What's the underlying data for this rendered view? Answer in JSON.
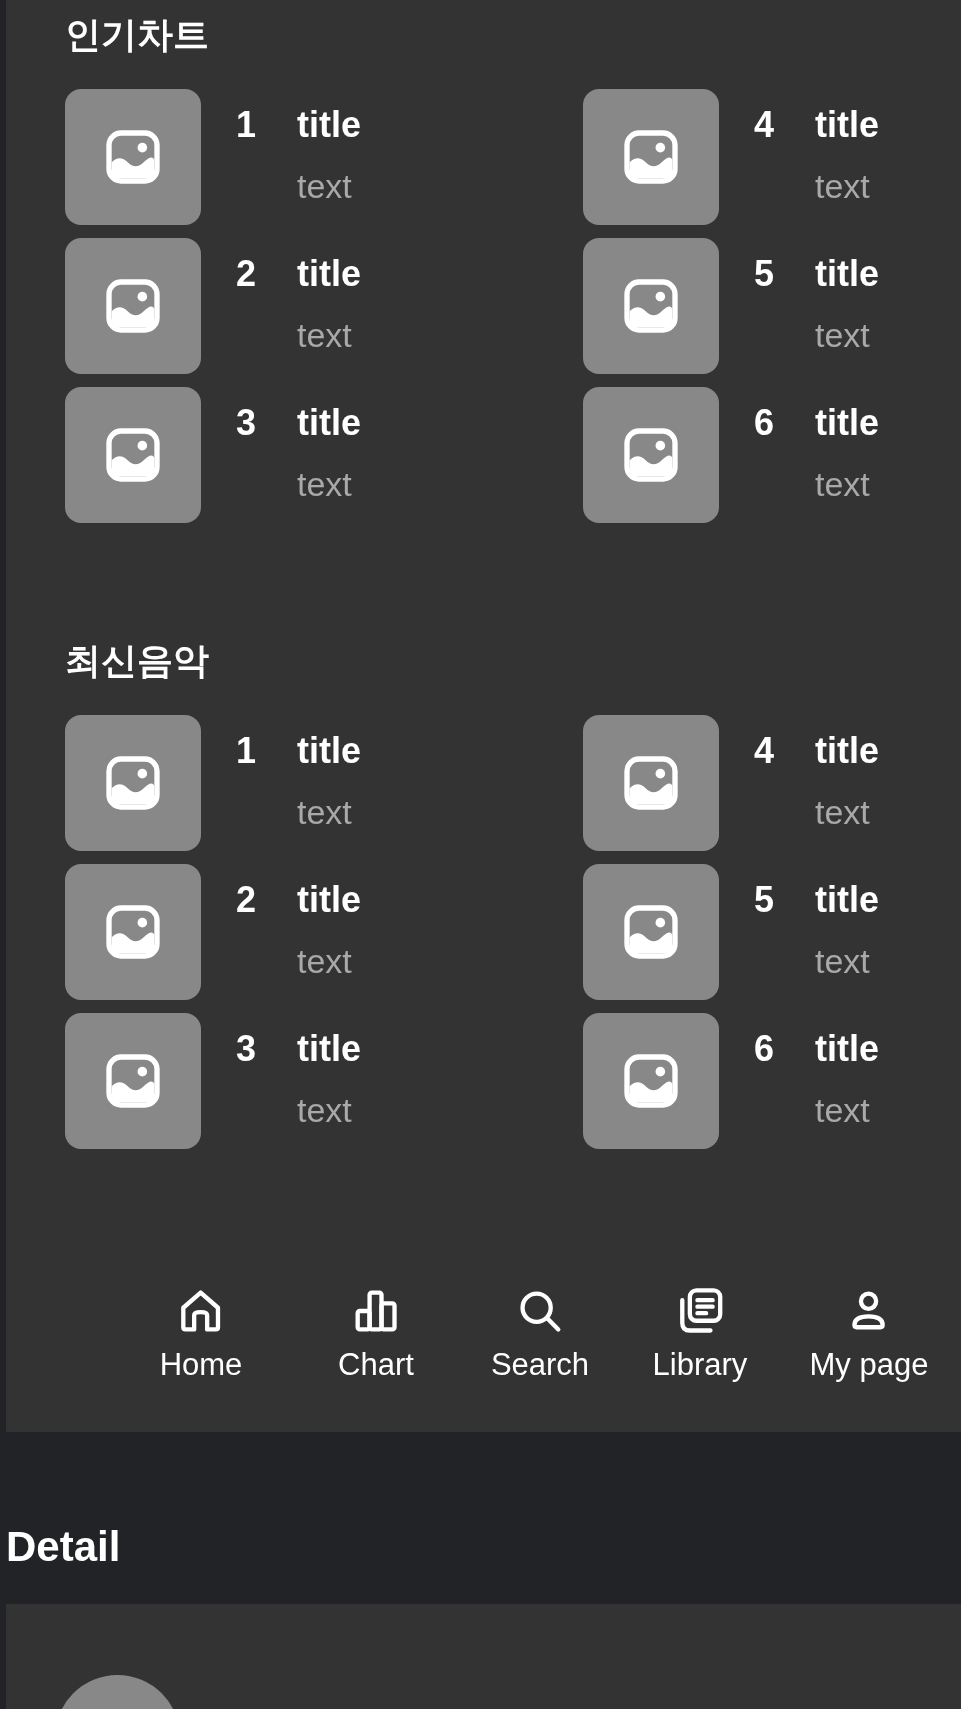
{
  "sections": [
    {
      "title": "인기차트",
      "items": [
        {
          "rank": "1",
          "title": "title",
          "text": "text"
        },
        {
          "rank": "2",
          "title": "title",
          "text": "text"
        },
        {
          "rank": "3",
          "title": "title",
          "text": "text"
        },
        {
          "rank": "4",
          "title": "title",
          "text": "text"
        },
        {
          "rank": "5",
          "title": "title",
          "text": "text"
        },
        {
          "rank": "6",
          "title": "title",
          "text": "text"
        }
      ]
    },
    {
      "title": "최신음악",
      "items": [
        {
          "rank": "1",
          "title": "title",
          "text": "text"
        },
        {
          "rank": "2",
          "title": "title",
          "text": "text"
        },
        {
          "rank": "3",
          "title": "title",
          "text": "text"
        },
        {
          "rank": "4",
          "title": "title",
          "text": "text"
        },
        {
          "rank": "5",
          "title": "title",
          "text": "text"
        },
        {
          "rank": "6",
          "title": "title",
          "text": "text"
        }
      ]
    }
  ],
  "nav": [
    {
      "kind": "home",
      "label": "Home"
    },
    {
      "kind": "chart",
      "label": "Chart"
    },
    {
      "kind": "search",
      "label": "Search"
    },
    {
      "kind": "library",
      "label": "Library"
    },
    {
      "kind": "profile",
      "label": "My page"
    }
  ],
  "detail": {
    "title": "Detail"
  }
}
